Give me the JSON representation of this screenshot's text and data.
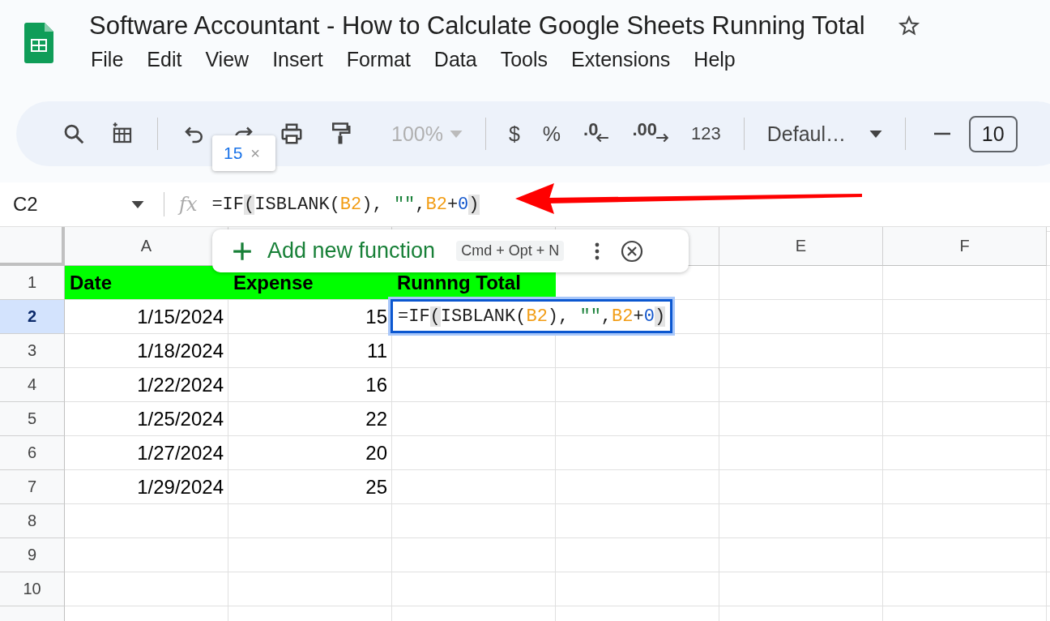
{
  "window": {
    "title": "Software Accountant - How to Calculate Google Sheets Running Total"
  },
  "menu": [
    "File",
    "Edit",
    "View",
    "Insert",
    "Format",
    "Data",
    "Tools",
    "Extensions",
    "Help"
  ],
  "toolbar": {
    "zoom": {
      "label": "100%",
      "disabled": true
    },
    "currency": "$",
    "percent": "%",
    "decrease_decimals": ".0",
    "increase_decimals": ".00",
    "number_format": "123",
    "font": "Defaul…",
    "font_size": "10"
  },
  "tooltip": {
    "value": "15",
    "close": "×"
  },
  "formula_bar": {
    "cell": "C2",
    "fx": "fx",
    "tokens": [
      {
        "text": "=IF",
        "kind": "plain"
      },
      {
        "text": "(",
        "kind": "paren"
      },
      {
        "text": "ISBLANK(",
        "kind": "plain"
      },
      {
        "text": "B2",
        "kind": "ref"
      },
      {
        "text": "), ",
        "kind": "plain"
      },
      {
        "text": "\"\"",
        "kind": "string"
      },
      {
        "text": ",",
        "kind": "plain"
      },
      {
        "text": "B2",
        "kind": "ref"
      },
      {
        "text": "+",
        "kind": "plain"
      },
      {
        "text": "0",
        "kind": "number"
      },
      {
        "text": ")",
        "kind": "paren"
      }
    ]
  },
  "function_popup": {
    "label": "Add new function",
    "shortcut": "Cmd + Opt + N"
  },
  "column_headers": [
    "A",
    "E",
    "F"
  ],
  "rows": [
    {
      "number": "1",
      "selected": false,
      "cells": [
        {
          "text": "Date",
          "kind": "header"
        },
        {
          "text": "Expense",
          "kind": "header"
        },
        {
          "text": "Runnng Total",
          "kind": "header"
        }
      ]
    },
    {
      "number": "2",
      "selected": true,
      "cells": [
        {
          "text": "1/15/2024",
          "kind": "number"
        },
        {
          "text": "15",
          "kind": "number"
        },
        {
          "kind": "editor",
          "tokens": [
            {
              "text": "=IF",
              "kind": "plain"
            },
            {
              "text": "(",
              "kind": "paren"
            },
            {
              "text": "ISBLANK(",
              "kind": "plain"
            },
            {
              "text": "B2",
              "kind": "ref"
            },
            {
              "text": "), ",
              "kind": "plain"
            },
            {
              "text": "\"\"",
              "kind": "string"
            },
            {
              "text": ",",
              "kind": "plain"
            },
            {
              "text": "B2",
              "kind": "ref"
            },
            {
              "text": "+",
              "kind": "plain"
            },
            {
              "text": "0",
              "kind": "number"
            },
            {
              "text": ")",
              "kind": "paren"
            }
          ]
        }
      ]
    },
    {
      "number": "3",
      "selected": false,
      "cells": [
        {
          "text": "1/18/2024",
          "kind": "number"
        },
        {
          "text": "11",
          "kind": "number"
        }
      ]
    },
    {
      "number": "4",
      "selected": false,
      "cells": [
        {
          "text": "1/22/2024",
          "kind": "number"
        },
        {
          "text": "16",
          "kind": "number"
        }
      ]
    },
    {
      "number": "5",
      "selected": false,
      "cells": [
        {
          "text": "1/25/2024",
          "kind": "number"
        },
        {
          "text": "22",
          "kind": "number"
        }
      ]
    },
    {
      "number": "6",
      "selected": false,
      "cells": [
        {
          "text": "1/27/2024",
          "kind": "number"
        },
        {
          "text": "20",
          "kind": "number"
        }
      ]
    },
    {
      "number": "7",
      "selected": false,
      "cells": [
        {
          "text": "1/29/2024",
          "kind": "number"
        },
        {
          "text": "25",
          "kind": "number"
        }
      ]
    },
    {
      "number": "8",
      "selected": false,
      "cells": []
    },
    {
      "number": "9",
      "selected": false,
      "cells": []
    },
    {
      "number": "10",
      "selected": false,
      "cells": []
    }
  ]
}
